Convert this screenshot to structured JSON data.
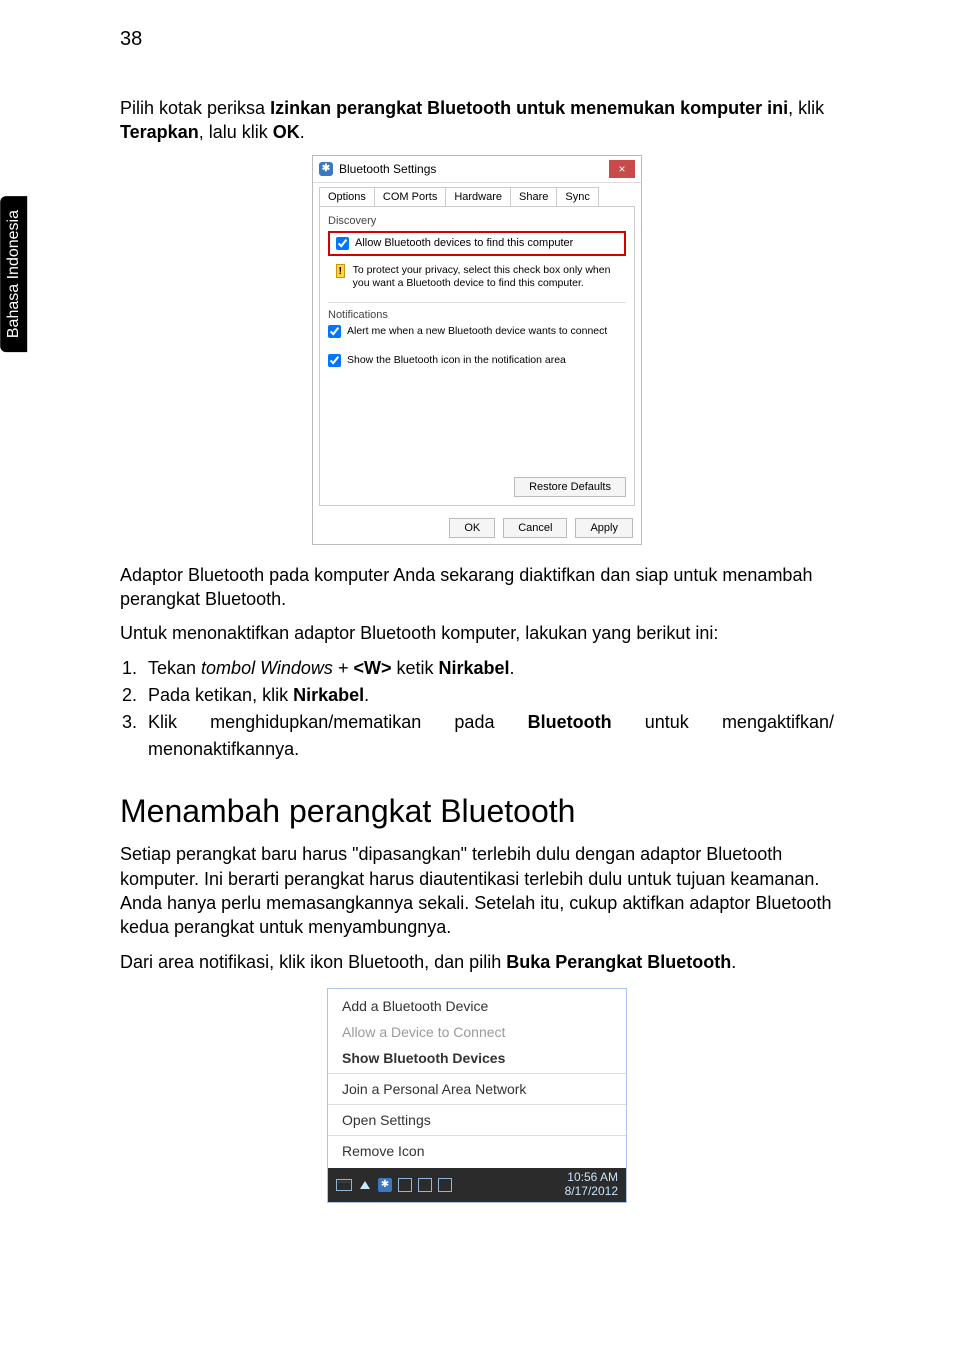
{
  "page_number": "38",
  "side_tab": "Bahasa\nIndonesia",
  "intro": {
    "line1_prefix": "Pilih kotak periksa ",
    "line1_bold": "Izinkan perangkat Bluetooth untuk menemukan komputer ini",
    "line1_suffix": ", klik ",
    "line1_bold2": "Terapkan",
    "line1_mid": ", lalu klik ",
    "line1_bold3": "OK",
    "line1_end": "."
  },
  "dialog": {
    "title": "Bluetooth Settings",
    "close": "×",
    "tabs": [
      "Options",
      "COM Ports",
      "Hardware",
      "Share",
      "Sync"
    ],
    "discovery_label": "Discovery",
    "allow_label": "Allow Bluetooth devices to find this computer",
    "warn_glyph": "!",
    "warn_text": "To protect your privacy, select this check box only when you want a Bluetooth device to find this computer.",
    "notifications_label": "Notifications",
    "alert_label": "Alert me when a new Bluetooth device wants to connect",
    "show_icon_label": "Show the Bluetooth icon in the notification area",
    "restore": "Restore Defaults",
    "ok": "OK",
    "cancel": "Cancel",
    "apply": "Apply"
  },
  "body": {
    "p1": "Adaptor Bluetooth pada komputer Anda sekarang diaktifkan dan siap untuk menambah perangkat Bluetooth.",
    "p2": "Untuk menonaktifkan adaptor Bluetooth komputer, lakukan yang berikut ini:",
    "li1_prefix": "Tekan ",
    "li1_italic": "tombol Windows",
    "li1_plus": " + ",
    "li1_key": "<W>",
    "li1_mid": " ketik ",
    "li1_bold": "Nirkabel",
    "li1_end": ".",
    "li2_prefix": "Pada ketikan, klik ",
    "li2_bold": "Nirkabel",
    "li2_end": ".",
    "li3_prefix": "Klik menghidupkan/mematikan pada ",
    "li3_bold": "Bluetooth",
    "li3_mid": " untuk mengaktifkan/ menonaktifkannya."
  },
  "heading2": "Menambah perangkat Bluetooth",
  "body2": {
    "p1": "Setiap perangkat baru harus \"dipasangkan\" terlebih dulu dengan adaptor Bluetooth komputer. Ini berarti perangkat harus diautentikasi terlebih dulu untuk tujuan keamanan. Anda hanya perlu memasangkannya sekali. Setelah itu, cukup aktifkan adaptor Bluetooth kedua perangkat untuk menyambungnya.",
    "p2_prefix": "Dari area notifikasi, klik ikon Bluetooth, dan pilih ",
    "p2_bold": "Buka Perangkat Bluetooth",
    "p2_end": "."
  },
  "menu": {
    "items": [
      {
        "label": "Add a Bluetooth Device",
        "style": "normal"
      },
      {
        "label": "Allow a Device to Connect",
        "style": "disabled"
      },
      {
        "label": "Show Bluetooth Devices",
        "style": "bold"
      },
      {
        "label": "Join a Personal Area Network",
        "style": "normal"
      },
      {
        "label": "Open Settings",
        "style": "normal"
      },
      {
        "label": "Remove Icon",
        "style": "normal"
      }
    ],
    "time": "10:56 AM",
    "date": "8/17/2012"
  }
}
